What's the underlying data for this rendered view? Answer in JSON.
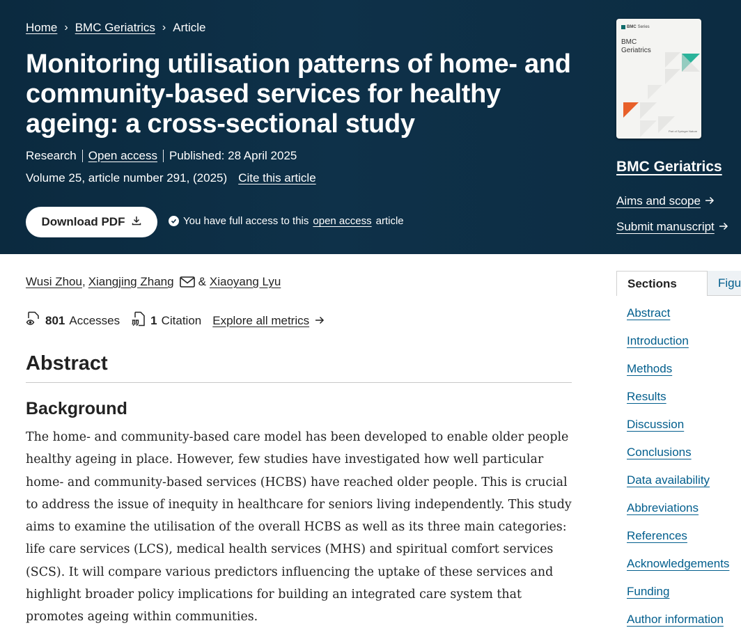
{
  "breadcrumb": {
    "home": "Home",
    "journal": "BMC Geriatrics",
    "current": "Article",
    "separator": "›"
  },
  "article": {
    "title": "Monitoring utilisation patterns of home- and community-based services for healthy ageing: a cross-sectional study",
    "type": "Research",
    "access": "Open access",
    "published": "Published: 28 April 2025",
    "volume": "Volume 25, article number 291, (2025)",
    "cite": "Cite this article"
  },
  "actions": {
    "download_label": "Download PDF",
    "access_prefix": "You have full access to this",
    "access_link": "open access",
    "access_suffix": "article"
  },
  "journal": {
    "cover_brand": "BMC",
    "cover_series": "Series",
    "cover_title_1": "BMC",
    "cover_title_2": "Geriatrics",
    "cover_footer": "Part of Springer Nature",
    "name": "BMC Geriatrics",
    "aims_label": "Aims and scope",
    "submit_label": "Submit manuscript"
  },
  "authors": {
    "a1": "Wusi Zhou",
    "comma": ",",
    "a2": "Xiangjing Zhang",
    "amp": "&",
    "a3": "Xiaoyang Lyu"
  },
  "metrics": {
    "accesses_count": "801",
    "accesses_label": "Accesses",
    "citations_count": "1",
    "citations_label": "Citation",
    "explore_label": "Explore all metrics"
  },
  "abstract": {
    "heading": "Abstract",
    "subheading": "Background",
    "text": "The home- and community-based care model has been developed to enable older people healthy ageing in place. However, few studies have investigated how well particular home- and community-based services (HCBS) have reached older people. This is crucial to address the issue of inequity in healthcare for seniors living independently. This study aims to examine the utilisation of the overall HCBS as well as its three main categories: life care services (LCS), medical health services (MHS) and spiritual comfort services (SCS). It will compare various predictors influencing the uptake of these services and highlight broader policy implications for building an integrated care system that promotes ageing within communities."
  },
  "sidebar": {
    "tab_sections": "Sections",
    "tab_figures": "Figures",
    "sections": [
      "Abstract",
      "Introduction",
      "Methods",
      "Results",
      "Discussion",
      "Conclusions",
      "Data availability",
      "Abbreviations",
      "References",
      "Acknowledgements",
      "Funding",
      "Author information"
    ]
  },
  "colors": {
    "hero_bg": "#0c2c42",
    "link_blue": "#025e8d",
    "cover_teal": "#2bb39a",
    "cover_orange": "#e8602a"
  }
}
